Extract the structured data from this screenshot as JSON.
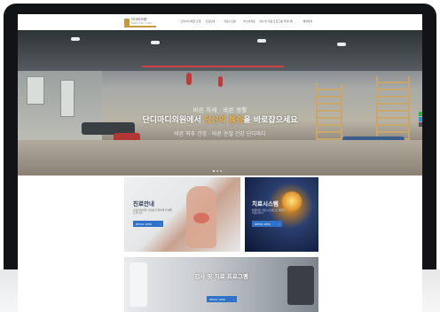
{
  "header": {
    "logo_name": "단디마디의원",
    "logo_sub": "DANDI MADI CLINIC",
    "nav": [
      "단디마디의원 소개",
      "진료안내",
      "치료시스템",
      "비수술치료",
      "검사 및 치료 프로그램",
      "커뮤니티",
      "예약문의"
    ]
  },
  "hero": {
    "subtitle": "바른 자세 · 바른 생활",
    "title_prefix": "단디마디의원",
    "title_mid": "에서 ",
    "title_highlight": "당신의 통증",
    "title_suffix": "을 바로잡으세요",
    "caption": "바른 척추 건강 · 바른 관절 건강 단디마디",
    "slide_count": 3,
    "active_slide": 1
  },
  "cards": [
    {
      "title": "진료안내",
      "desc": "단디마디의원 진료를 친절하게 안내해 드립니다.",
      "button": "DETAIL VIEW"
    },
    {
      "title": "치료시스템",
      "desc": "체계적인 치료시스템으로 통증을 치료합니다.",
      "button": "DETAIL VIEW"
    },
    {
      "title": "검사 및 치료 프로그램",
      "desc": "",
      "button": "DETAIL VIEW"
    }
  ],
  "colors": {
    "accent": "#2f73c9",
    "brand_gold": "#c79a3a",
    "highlight": "#f0b64a"
  }
}
